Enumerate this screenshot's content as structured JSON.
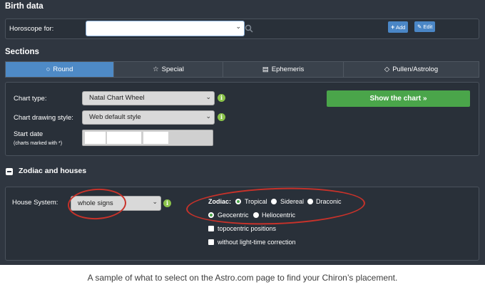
{
  "birth_data": {
    "title": "Birth data",
    "horoscope_label": "Horoscope for:",
    "add_label": "Add",
    "edit_label": "Edit"
  },
  "sections": {
    "title": "Sections",
    "tabs": [
      {
        "label": "Round",
        "icon": "circle-icon",
        "active": true
      },
      {
        "label": "Special",
        "icon": "star-icon",
        "active": false
      },
      {
        "label": "Ephemeris",
        "icon": "document-icon",
        "active": false
      },
      {
        "label": "Pullen/Astrolog",
        "icon": "diamond-icon",
        "active": false
      }
    ]
  },
  "chart_options": {
    "chart_type_label": "Chart type:",
    "chart_type_value": "Natal Chart Wheel",
    "drawing_style_label": "Chart drawing style:",
    "drawing_style_value": "Web default style",
    "start_date_label": "Start date",
    "start_date_note": "(charts marked with *)",
    "show_button": "Show the chart »"
  },
  "zodiac_houses": {
    "title": "Zodiac and houses",
    "house_system_label": "House System:",
    "house_system_value": "whole signs",
    "zodiac_label": "Zodiac:",
    "zodiac_options": [
      "Tropical",
      "Sidereal",
      "Draconic"
    ],
    "center_options": [
      "Geocentric",
      "Heliocentric"
    ],
    "topocentric_label": "topocentric positions",
    "light_time_label": "without light-time correction"
  },
  "caption": "A sample of what to select on the Astro.com page to find your Chiron’s placement.",
  "colors": {
    "background": "#2f3640",
    "accent_blue": "#4e8ac6",
    "show_green": "#4aa54a",
    "highlight_red": "#c8322a"
  }
}
